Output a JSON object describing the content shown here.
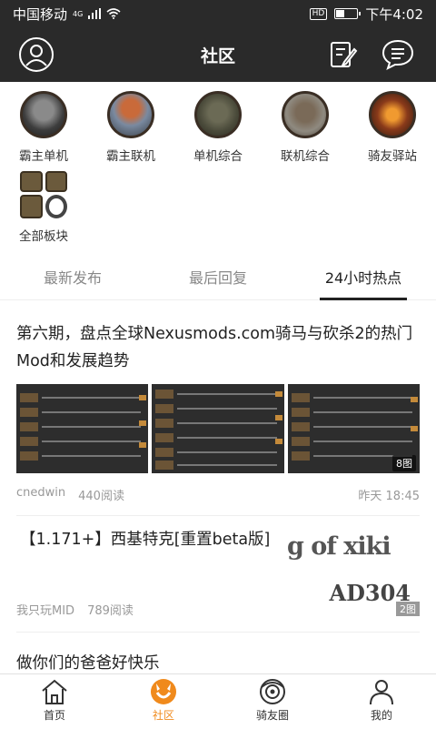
{
  "status": {
    "carrier": "中国移动",
    "network": "4G",
    "hd": "HD",
    "time": "下午4:02",
    "battery_level": 0.45
  },
  "header": {
    "title": "社区",
    "left_icon": "user-icon",
    "right_icons": [
      "edit-icon",
      "message-icon"
    ]
  },
  "categories": [
    {
      "label": "霸主单机"
    },
    {
      "label": "霸主联机"
    },
    {
      "label": "单机综合"
    },
    {
      "label": "联机综合"
    },
    {
      "label": "骑友驿站"
    },
    {
      "label": "全部板块"
    }
  ],
  "tabs": [
    {
      "label": "最新发布"
    },
    {
      "label": "最后回复"
    },
    {
      "label": "24小时热点",
      "active": true
    }
  ],
  "posts": [
    {
      "title": "第六期，盘点全球Nexusmods.com骑马与砍杀2的热门Mod和发展趋势",
      "image_count": "8图",
      "author": "cnedwin",
      "views": "440阅读",
      "time": "昨天 18:45"
    },
    {
      "title": "【1.171+】西基特克[重置beta版]",
      "image_text_1": "g of xiki",
      "image_text_2": "AD304",
      "image_count": "2图",
      "author": "我只玩MID",
      "views": "789阅读"
    },
    {
      "title": "做你们的爸爸好快乐"
    }
  ],
  "nav": [
    {
      "label": "首页"
    },
    {
      "label": "社区",
      "active": true
    },
    {
      "label": "骑友圈"
    },
    {
      "label": "我的"
    }
  ],
  "colors": {
    "header_bg": "#2a2a2a",
    "accent": "#f08a1c"
  }
}
